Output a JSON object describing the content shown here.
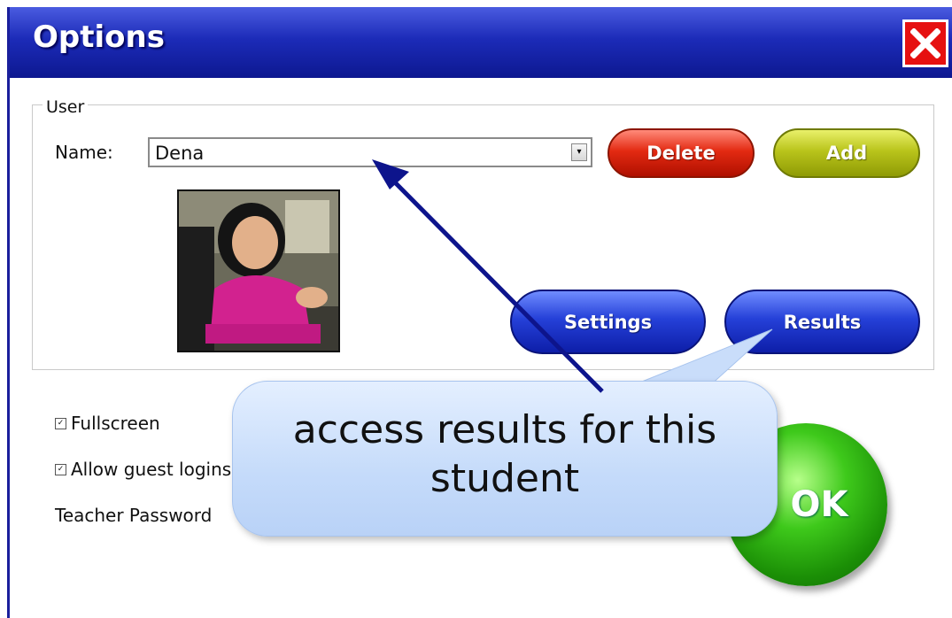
{
  "window": {
    "title": "Options"
  },
  "user_group": {
    "legend": "User",
    "name_label": "Name:",
    "name_value": "Dena",
    "delete_label": "Delete",
    "add_label": "Add",
    "settings_label": "Settings",
    "results_label": "Results"
  },
  "options": {
    "fullscreen_label": "Fullscreen",
    "fullscreen_checked": true,
    "guest_label": "Allow guest logins",
    "guest_checked": true,
    "password_label": "Teacher Password",
    "ok_label": "OK"
  },
  "callout": {
    "line1": "access results for this",
    "line2": "student"
  },
  "colors": {
    "title_bar": "#1c2bb8",
    "close": "#e61010",
    "delete": "#e32a12",
    "add": "#b9c41b",
    "blue_button": "#2540d8",
    "ok": "#3ec91b",
    "callout": "#c5dbfa",
    "arrow": "#0d148c"
  },
  "icons": {
    "close": "close-icon",
    "dropdown": "chevron-down-icon",
    "checkbox": "check-icon"
  }
}
